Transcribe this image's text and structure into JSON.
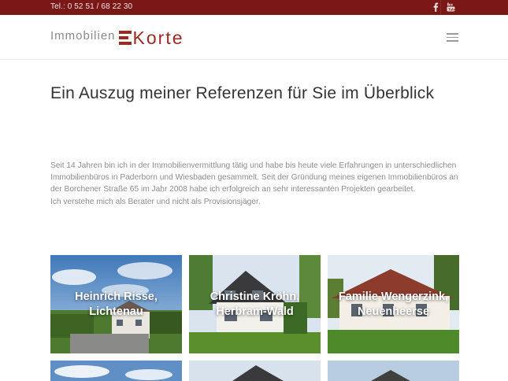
{
  "topbar": {
    "phone": "Tel.: 0 52 51 / 68 22 30",
    "social": [
      {
        "name": "facebook-icon"
      },
      {
        "name": "youtube-icon"
      }
    ]
  },
  "header": {
    "logo_left": "Immobilien",
    "logo_right": "Korte"
  },
  "main": {
    "title": "Ein Auszug meiner Referenzen für Sie im Überblick",
    "intro_lines": [
      "Seit 14 Jahren bin ich in der Immobilienvermittlung tätig und habe bis heute viele Erfahrungen in unterschiedlichen Immobilienbüros in Paderborn und Wiesbaden gesammelt. Seit der Gründung meines eigenen Immobilienbüros an der Borchener Straße 65 im Jahr 2008 habe ich erfolgreich an sehr interessanten Projekten gearbeitet.",
      "Ich verstehe mich als Berater und nicht als Provisionsjäger."
    ],
    "references": [
      {
        "label": "Heinrich Risse, Lichtenau"
      },
      {
        "label": "Christine Kröhn, Herbram-Wald"
      },
      {
        "label": "Familie Wengerzink, Neuenheerse"
      }
    ]
  },
  "colors": {
    "brand": "#7a1717",
    "logo_accent": "#9b2a22"
  }
}
